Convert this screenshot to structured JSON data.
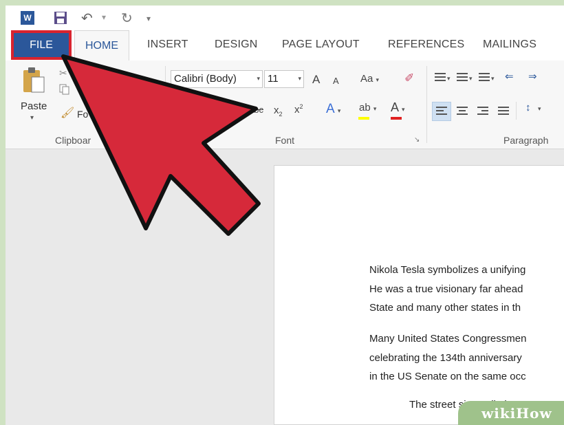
{
  "app": {
    "logo_letter": "W"
  },
  "tabs": [
    "FILE",
    "HOME",
    "INSERT",
    "DESIGN",
    "PAGE LAYOUT",
    "REFERENCES",
    "MAILINGS"
  ],
  "ribbon": {
    "clipboard": {
      "paste_label": "Paste",
      "format_painter_label": "Fo",
      "group_label": "Clipboar"
    },
    "font": {
      "font_name": "Calibri (Body)",
      "font_size": "11",
      "grow": "A",
      "shrink": "A",
      "change_case": "Aa",
      "strike": "abc",
      "subscript": "x",
      "sub_mark": "2",
      "superscript": "x",
      "sup_mark": "2",
      "effects": "A",
      "highlight": "ab",
      "font_color": "A",
      "group_label": "Font"
    },
    "paragraph": {
      "group_label": "Paragraph"
    }
  },
  "document": {
    "paragraphs": [
      [
        "Nikola Tesla symbolizes a unifying",
        "He was a true visionary far ahead",
        "State and many other states in th"
      ],
      [
        "Many United States Congressmen",
        "celebrating the 134th anniversary",
        "in the US Senate on the same occ"
      ],
      [
        "The street sign “Nikola Tes"
      ]
    ]
  },
  "watermark": "wikiHow",
  "colors": {
    "file_tab": "#2b579a",
    "highlight_box": "#d9232e",
    "arrow_fill": "#d6293a",
    "frame": "#cfe2c2",
    "highlight_yellow": "#ffff00",
    "font_red": "#e02020"
  }
}
